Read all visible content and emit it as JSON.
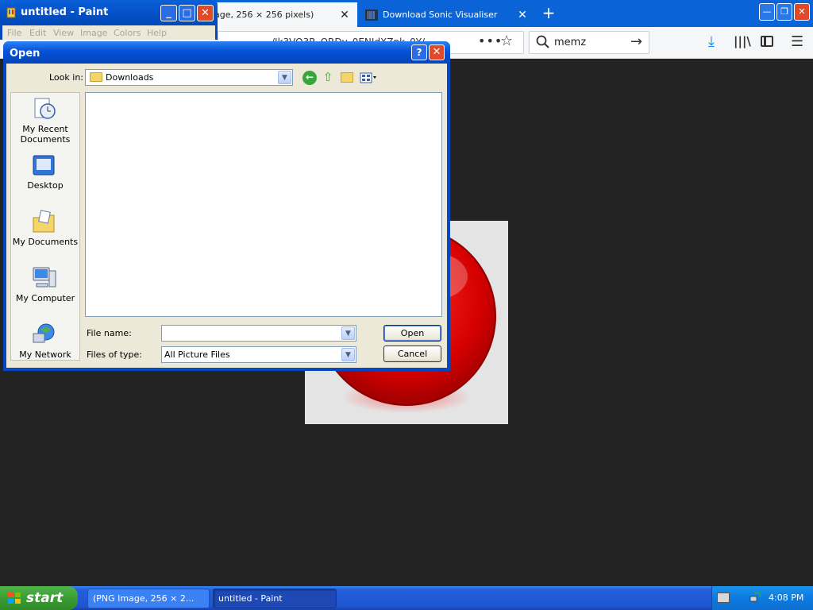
{
  "firefox": {
    "tabs": [
      {
        "title": "age, 256 × 256 pixels)",
        "close": "✕"
      },
      {
        "title": "Download Sonic Visualiser",
        "close": "✕"
      }
    ],
    "new_tab": "+",
    "window_buttons": {
      "minimize": "—",
      "restore": "❐",
      "close": "✕"
    },
    "url_text": "…/Jk3VO3R_ORDy_0ENJdXZpk_0Y/…",
    "page_actions": "•••",
    "bookmark_star": "☆",
    "search": {
      "value": "memz",
      "go": "→"
    },
    "downloads_icon": "⤓",
    "library_icon": "|||\\",
    "menu_icon": "☰"
  },
  "paint": {
    "title": "untitled - Paint",
    "buttons": {
      "minimize": "_",
      "maximize": "□",
      "close": "✕"
    },
    "menu": [
      "File",
      "Edit",
      "View",
      "Image",
      "Colors",
      "Help"
    ]
  },
  "open_dialog": {
    "title": "Open",
    "help": "?",
    "close": "✕",
    "look_in_label": "Look in:",
    "look_in_value": "Downloads",
    "places": [
      "My Recent Documents",
      "Desktop",
      "My Documents",
      "My Computer",
      "My Network"
    ],
    "file_name_label": "File name:",
    "file_name_value": "",
    "files_of_type_label": "Files of type:",
    "files_of_type_value": "All Picture Files",
    "open_button": "Open",
    "cancel_button": "Cancel"
  },
  "taskbar": {
    "start": "start",
    "tasks": [
      "(PNG Image, 256 × 2...",
      "untitled - Paint"
    ],
    "clock": "4:08 PM"
  },
  "colors": {
    "xp_blue": "#0548c2",
    "start_green": "#3c9c35",
    "firefox_blue": "#0a64d8"
  }
}
